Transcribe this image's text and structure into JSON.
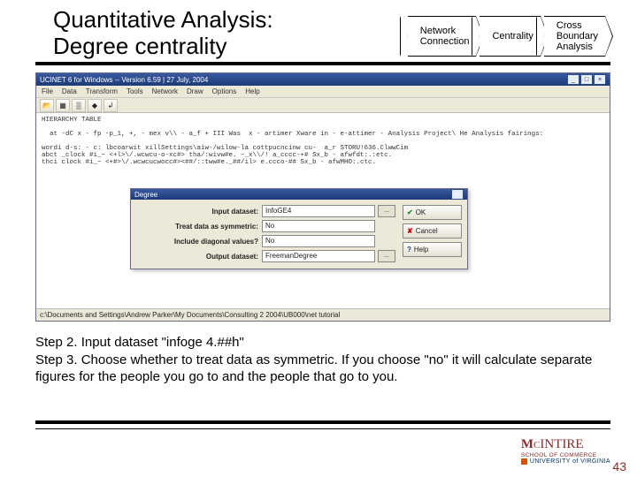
{
  "title_l1": "Quantitative Analysis:",
  "title_l2": "Degree centrality",
  "chevrons": [
    "Network\nConnection",
    "Centrality",
    "Cross\nBoundary\nAnalysis"
  ],
  "app": {
    "title": "UCINET 6 for Windows -- Version 6.59 | 27 July, 2004",
    "menus": [
      "File",
      "Data",
      "Transform",
      "Tools",
      "Network",
      "Draw",
      "Options",
      "Help"
    ],
    "content_lines": [
      "HIERARCHY TABLE",
      "",
      "  at -dC x - fp -p_1, +, - mex v\\\\ - a_f + III Was  x - artimer Xware in - e-attimer - Analysis Project\\ He Analysis fairings:",
      "",
      "wordi d-s: - c: lbcoarwit xillSettings\\aiw-/wilow-la cottpucncinw cu-  a_r STORU!636.ClwwCim",
      "abct _clock #i_~ <+l>\\/.wcwcu-o-xc#> tha/:wivw#e. ~_x\\\\/! a_cccc-+# Sx_b - afwfdt:.:etc.",
      "thci clock #i_~ <+#>\\/.wcwcucwocc#><##/::tww#e._##/il> e.ccco-## Sx_b - afwMHO:.ctc."
    ],
    "status": "c:\\Documents and Settings\\Andrew Parker\\My Documents\\Consulting 2 2004\\UB000\\net tutorial"
  },
  "dialog": {
    "title": "Degree",
    "rows": [
      {
        "label": "Input dataset:",
        "value": "InfoGE4",
        "dots": true
      },
      {
        "label": "Treat data as symmetric:",
        "value": "No",
        "dots": false
      },
      {
        "label": "Include diagonal values?",
        "value": "No",
        "dots": false
      },
      {
        "label": "Output dataset:",
        "value": "FreemanDegree",
        "dots": true
      }
    ],
    "buttons": [
      {
        "icon": "check",
        "label": "OK"
      },
      {
        "icon": "x",
        "label": "Cancel"
      },
      {
        "icon": "q",
        "label": "Help"
      }
    ]
  },
  "steps": "Step 2. Input dataset \"infoge 4.##h\"\nStep 3. Choose whether to treat data as symmetric.  If you choose \"no\" it will calculate separate figures for the people you go to and the people that go to you.",
  "logo": {
    "line1": "McINTIRE",
    "line2": "SCHOOL OF COMMERCE",
    "line3": "UNIVERSITY of VIRGINIA"
  },
  "page": "43"
}
